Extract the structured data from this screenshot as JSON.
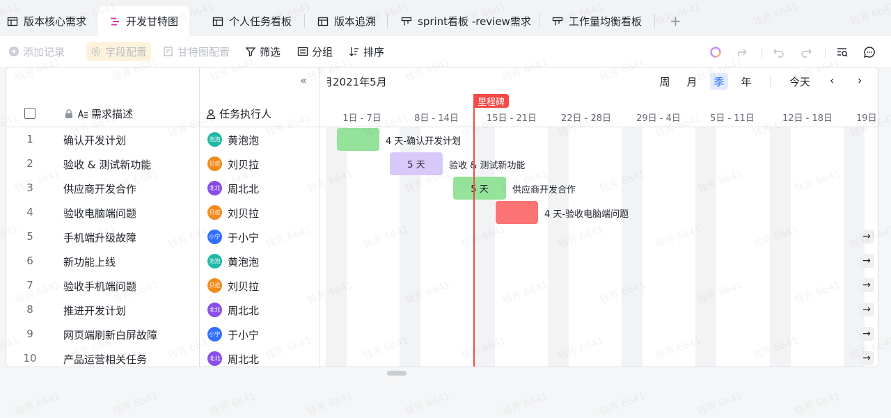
{
  "tabs": [
    {
      "label": "版本核心需求",
      "icon": "table-icon"
    },
    {
      "label": "开发甘特图",
      "icon": "gantt-icon",
      "active": true
    },
    {
      "label": "个人任务看板",
      "icon": "table-icon"
    },
    {
      "label": "版本追溯",
      "icon": "table-icon"
    },
    {
      "label": "sprint看板 -review需求",
      "icon": "kanban-icon"
    },
    {
      "label": "工作量均衡看板",
      "icon": "kanban-icon"
    }
  ],
  "toolbar": {
    "add_record": "添加记录",
    "field_config": "字段配置",
    "gantt_config": "甘特图配置",
    "filter": "筛选",
    "group": "分组",
    "sort": "排序"
  },
  "table": {
    "col_desc": "需求描述",
    "col_assignee": "任务执行人",
    "rows": [
      {
        "num": "1",
        "desc": "确认开发计划",
        "assignee": "黄泡泡",
        "avatar": "泡泡",
        "color": "#1fb8a6"
      },
      {
        "num": "2",
        "desc": "验收 & 测试新功能",
        "assignee": "刘贝拉",
        "avatar": "贝拉",
        "color": "#f28b1d"
      },
      {
        "num": "3",
        "desc": "供应商开发合作",
        "assignee": "周北北",
        "avatar": "北北",
        "color": "#8a4dea"
      },
      {
        "num": "4",
        "desc": "验收电脑端问题",
        "assignee": "刘贝拉",
        "avatar": "贝拉",
        "color": "#f28b1d"
      },
      {
        "num": "5",
        "desc": "手机端升级故障",
        "assignee": "于小宁",
        "avatar": "小宁",
        "color": "#3370ff"
      },
      {
        "num": "6",
        "desc": "新功能上线",
        "assignee": "黄泡泡",
        "avatar": "泡泡",
        "color": "#1fb8a6"
      },
      {
        "num": "7",
        "desc": "验收手机端问题",
        "assignee": "刘贝拉",
        "avatar": "贝拉",
        "color": "#f28b1d"
      },
      {
        "num": "8",
        "desc": "推进开发计划",
        "assignee": "周北北",
        "avatar": "北北",
        "color": "#8a4dea"
      },
      {
        "num": "9",
        "desc": "网页端刷新白屏故障",
        "assignee": "于小宁",
        "avatar": "小宁",
        "color": "#3370ff"
      },
      {
        "num": "10",
        "desc": "产品运营相关任务",
        "assignee": "周北北",
        "avatar": "北北",
        "color": "#8a4dea"
      }
    ]
  },
  "gantt": {
    "month": "2021年5月",
    "month_partial": "月",
    "views": [
      "周",
      "月",
      "季",
      "年"
    ],
    "active_view": "季",
    "today": "今天",
    "weeks": [
      "1日 - 7日",
      "8日 - 14日",
      "15日 - 21日",
      "22日 - 28日",
      "29日 - 4日",
      "5日 - 11日",
      "12日 - 18日",
      "19日"
    ],
    "milestone": "里程碑",
    "bars": [
      {
        "row": 0,
        "inside": "",
        "outside": "4 天-确认开发计划",
        "color": "#95e29a"
      },
      {
        "row": 1,
        "inside": "5 天",
        "outside": "验收 & 测试新功能",
        "color": "#d9c9fb"
      },
      {
        "row": 2,
        "inside": "5 天",
        "outside": "供应商开发合作",
        "color": "#95e29a"
      },
      {
        "row": 3,
        "inside": "",
        "outside": "4 天-验收电脑端问题",
        "color": "#fb7373"
      }
    ],
    "off_arrow": "→"
  },
  "watermark": "钱芳 6641"
}
